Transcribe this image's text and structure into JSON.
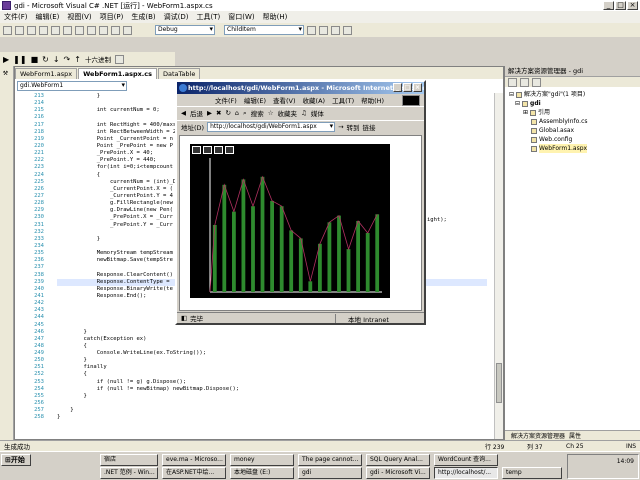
{
  "vs": {
    "title": "gdi - Microsoft Visual C# .NET [运行] - WebForm1.aspx.cs",
    "menu": [
      "文件(F)",
      "编辑(E)",
      "视图(V)",
      "项目(P)",
      "生成(B)",
      "调试(D)",
      "工具(T)",
      "窗口(W)",
      "帮助(H)"
    ],
    "config_combo": "Debug",
    "find_combo": "ChildItem",
    "hex_label": "十六进制",
    "tabs": [
      "WebForm1.aspx",
      "WebForm1.aspx.cs",
      "DataTable"
    ],
    "code_combo": "gdi.WebForm1",
    "line_numbers": [
      "213",
      "214",
      "215",
      "216",
      "217",
      "218",
      "219",
      "220",
      "221",
      "222",
      "223",
      "224",
      "225",
      "226",
      "227",
      "228",
      "229",
      "230",
      "231",
      "232",
      "233",
      "234",
      "235",
      "236",
      "237",
      "238",
      "239",
      "240",
      "241",
      "242",
      "243",
      "244",
      "245",
      "246",
      "247",
      "248",
      "249",
      "250",
      "251",
      "252",
      "253",
      "254",
      "255",
      "256",
      "257",
      "258"
    ],
    "code_lines": [
      "            }",
      "",
      "            int currentNum = 0;",
      "",
      "            int RectHight = 400/maxs",
      "            int RectBetweenWidth = 2",
      "            Point _CurrentPoint = n",
      "            Point _PrePoint = new P",
      "            _PrePoint.X = 40;",
      "            _PrePoint.Y = 440;",
      "            for(int i=0;i<tempcount",
      "            {",
      "                currentNum = (int)_D",
      "                _CurrentPoint.X = (",
      "                _CurrentPoint.Y = 4",
      "                g.FillRectangle(new",
      "                g.DrawLine(new Pen(",
      "                _PrePoint.X = _Curr",
      "                _PrePoint.Y = _Curr",
      "",
      "            }",
      "",
      "            MemoryStream tempStream",
      "            newBitmap.Save(tempStre",
      "",
      "            Response.ClearContent()",
      "            Response.ContentType =",
      "            Response.BinaryWrite(te",
      "            Response.End();",
      "",
      "",
      "",
      "",
      "        }",
      "        catch(Exception ex)",
      "        {",
      "            Console.WriteLine(ex.ToString());",
      "        }",
      "        finally",
      "        {",
      "            if (null != g) g.Dispose();",
      "            if (null != newBitmap) newBitmap.Dispose();",
      "        }",
      "",
      "    }",
      "}"
    ],
    "code_tail": "ight);",
    "status_left": "生成成功",
    "status_ln": "行 239",
    "status_col": "列 37",
    "status_ch": "Ch 25",
    "status_ins": "INS"
  },
  "solution": {
    "title": "解决方案资源管理器 - gdi",
    "items": [
      "解决方案\"gdi\"(1 项目)",
      "gdi",
      "引用",
      "AssemblyInfo.cs",
      "Global.asax",
      "Web.config",
      "WebForm1.aspx"
    ],
    "bottom_tabs": [
      "解决方案资源管理器",
      "属性"
    ]
  },
  "ie": {
    "title": "http://localhost/gdi/WebForm1.aspx - Microsoft Internet Explorer",
    "menu": [
      "文件(F)",
      "编辑(E)",
      "查看(V)",
      "收藏(A)",
      "工具(T)",
      "帮助(H)"
    ],
    "nav": [
      "后退",
      "搜索",
      "收藏夹",
      "媒体"
    ],
    "addr_label": "地址(D)",
    "url": "http://localhost/gdi/WebForm1.aspx",
    "go": "转到",
    "links": "链接",
    "status": "完毕",
    "zone": "本地 Intranet"
  },
  "chart_data": {
    "type": "bar",
    "values": [
      50,
      80,
      60,
      84,
      64,
      86,
      68,
      64,
      46,
      40,
      8,
      36,
      52,
      57,
      32,
      53,
      44,
      58
    ],
    "ylim": [
      0,
      100
    ],
    "bar_color": "#2e8b2e",
    "line_color": "#b03060",
    "background": "#000000"
  },
  "taskbar": {
    "start": "开始",
    "buttons_row1": [
      "宿店",
      "eve.ma - Microso...",
      "money",
      "The page cannot...",
      "SQL Query Anal...",
      "WordCount 查询..."
    ],
    "buttons_row2": [
      ".NET 范例 - Win...",
      "在ASP.NET中绘...",
      "本地磁盘 (E:)",
      "gdi",
      "gdi - Microsoft Vi...",
      "http://localhost/...",
      "temp"
    ],
    "clock": "14:09"
  }
}
